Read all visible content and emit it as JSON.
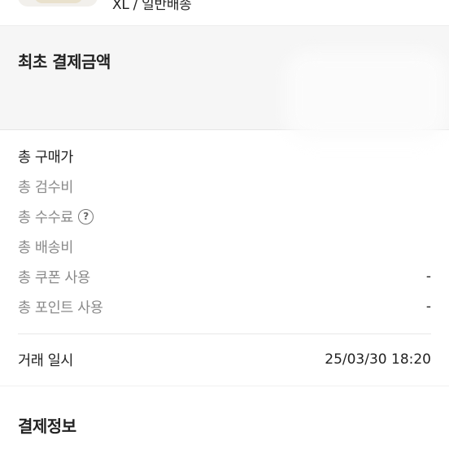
{
  "product": {
    "option": "XL / 일반배송"
  },
  "payment": {
    "title": "최초 결제금액"
  },
  "details": {
    "total_price": "총 구매가",
    "inspection_fee": "총 검수비",
    "commission_fee": "총 수수료",
    "shipping_fee": "총 배송비",
    "coupon_used": "총 쿠폰 사용",
    "coupon_value": "-",
    "points_used": "총 포인트 사용",
    "points_value": "-"
  },
  "transaction": {
    "label": "거래 일시",
    "value": "25/03/30 18:20"
  },
  "payment_info": {
    "title": "결제정보"
  },
  "icons": {
    "help": "question-circle-icon"
  }
}
